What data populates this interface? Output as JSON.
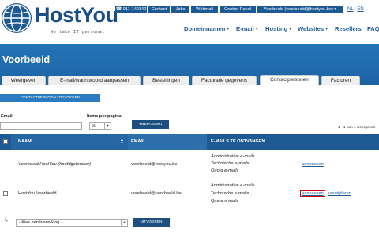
{
  "header": {
    "brand": "HostYou",
    "tagline": "We take IT personal",
    "topbar": {
      "phone": "011-140140",
      "contact": "Contact",
      "jobs": "Jobs",
      "webmail": "Webmail",
      "control_panel": "Control Panel",
      "account": "Voorbeeld (voorbeeld@hostyou.be)",
      "account_caret": "▾",
      "lang_nl": "NL",
      "lang_sep": "|",
      "lang_en": "EN"
    },
    "nav": [
      {
        "label": "Domeinnamen",
        "caret": "▾"
      },
      {
        "label": "E-mail",
        "caret": "▾"
      },
      {
        "label": "Hosting",
        "caret": "▾"
      },
      {
        "label": "Websites",
        "caret": "▾"
      },
      {
        "label": "Resellers",
        "caret": ""
      },
      {
        "label": "FAQ",
        "caret": ""
      }
    ]
  },
  "page": {
    "title": "Voorbeeld",
    "tabs": [
      {
        "label": "Weergeven"
      },
      {
        "label": "E-mail/wachtwoord aanpassen"
      },
      {
        "label": "Bestellingen"
      },
      {
        "label": "Facturatie gegevens"
      },
      {
        "label": "Contactpersonen",
        "active": true
      },
      {
        "label": "Facturen"
      }
    ]
  },
  "content": {
    "add_button": "CONTACTPERSOON TOEVOEGEN",
    "filter": {
      "email_label": "Email",
      "email_value": "",
      "items_label": "Items per pagina",
      "items_value": "50",
      "apply_button": "TOEPASSEN"
    },
    "count_text": "1 - 1 van 1 weergeven",
    "table": {
      "headers": {
        "name": "NAAM",
        "email": "EMAIL",
        "receives": "E-MAILS TE ONTVANGEN"
      },
      "rows": [
        {
          "name": "Voorbeeld HostYou (hoofdgebruiker)",
          "email": "voorbeeld@hostyou.be",
          "mails": [
            "Administrative e-mails",
            "Technische e-mails",
            "Quota e-mails"
          ],
          "edit": "aanpassen",
          "delete": ""
        },
        {
          "name": "HostYou Voorbeeld",
          "email": "voorbeeld@voorbeeld.be",
          "mails": [
            "Administrative e-mails",
            "Technische e-mails",
            "Quota e-mails"
          ],
          "edit": "aanpassen",
          "delete": "verwijderen"
        }
      ]
    },
    "bulk": {
      "select_value": "- Kies een bewerking -",
      "run_button": "UITVOEREN"
    }
  },
  "colors": {
    "brand_blue": "#1d5a94",
    "banner_blue": "#2474b8",
    "highlight_red": "#d0021b"
  },
  "icons": {
    "logo": "globe-logo-icon",
    "phone": "phone-icon",
    "sort": "sort-icon",
    "bulk": "bulk-arrow-icon"
  }
}
